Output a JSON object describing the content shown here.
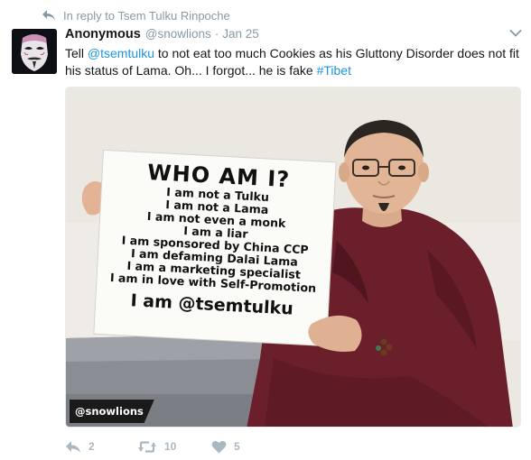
{
  "reply_context": {
    "icon": "reply-arrow-icon",
    "text": "In reply to Tsem Tulku Rinpoche"
  },
  "author": {
    "avatar": "anonymous-mask-avatar",
    "fullname": "Anonymous",
    "screenname": "@snowlions",
    "separator": "·",
    "date": "Jan 25"
  },
  "menu_icon": "chevron-down-icon",
  "tweet": {
    "part1": "Tell ",
    "mention": "@tsemtulku",
    "part2": " to not eat too much Cookies as his Gluttony Disorder does not fit his status of Lama. Oh... I forgot... he is fake ",
    "hashtag": "#Tibet"
  },
  "media": {
    "sign": {
      "title": "WHO AM I?",
      "lines": [
        "I am not a Tulku",
        "I am not a Lama",
        "I am not even a monk",
        "I am a liar",
        "I am sponsored by China CCP",
        "I am defaming Dalai Lama",
        "I am a marketing specialist",
        "I am in love with Self-Promotion"
      ],
      "handle": "I am @tsemtulku"
    },
    "watermark": "@snowlions"
  },
  "actions": {
    "reply": {
      "icon": "reply-icon",
      "count": "2"
    },
    "retweet": {
      "icon": "retweet-icon",
      "count": "10"
    },
    "like": {
      "icon": "heart-icon",
      "count": "5"
    }
  },
  "colors": {
    "link": "#1b95e0",
    "muted": "#8899a6",
    "action": "#aab8c2",
    "robe": "#6b1f2a"
  }
}
